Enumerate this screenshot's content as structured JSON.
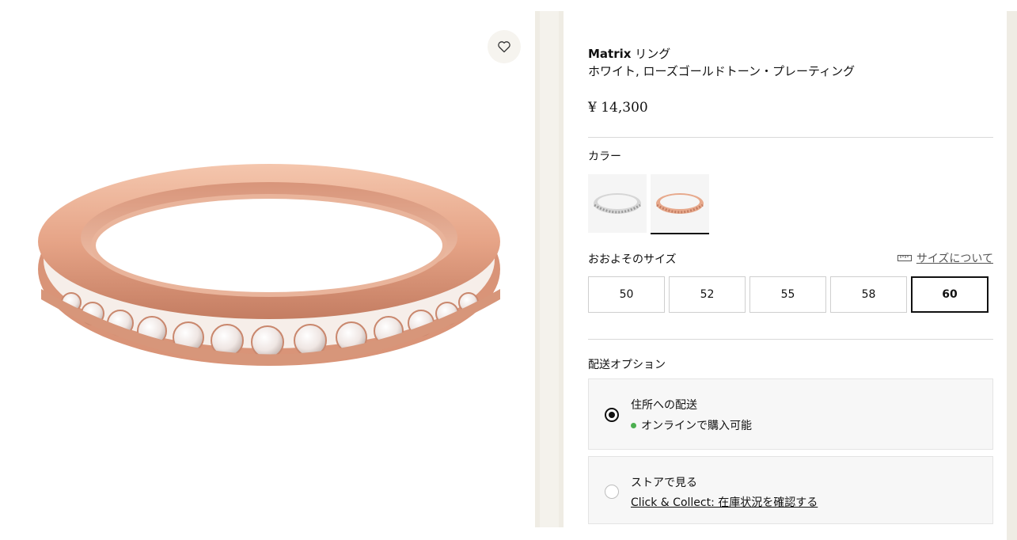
{
  "product": {
    "brand": "Matrix",
    "name": "リング",
    "variant": "ホワイト, ローズゴールドトーン・プレーティング",
    "price": "¥ 14,300"
  },
  "color": {
    "label": "カラー",
    "options": [
      {
        "name": "silver-ring-swatch",
        "selected": false
      },
      {
        "name": "rose-gold-ring-swatch",
        "selected": true
      }
    ]
  },
  "size": {
    "label": "おおよそのサイズ",
    "guide_link": "サイズについて",
    "options": [
      "50",
      "52",
      "55",
      "58",
      "60"
    ],
    "selected": "60"
  },
  "delivery": {
    "label": "配送オプション",
    "options": [
      {
        "title": "住所への配送",
        "sub": "オンラインで購入可能",
        "selected": true
      },
      {
        "title": "ストアで見る",
        "sub": "Click & Collect: 在庫状況を確認する",
        "selected": false
      }
    ]
  },
  "colors": {
    "accent": "#111111",
    "band": "#efece4",
    "available": "#4caf50",
    "rose_gold": "#e7a98c"
  }
}
